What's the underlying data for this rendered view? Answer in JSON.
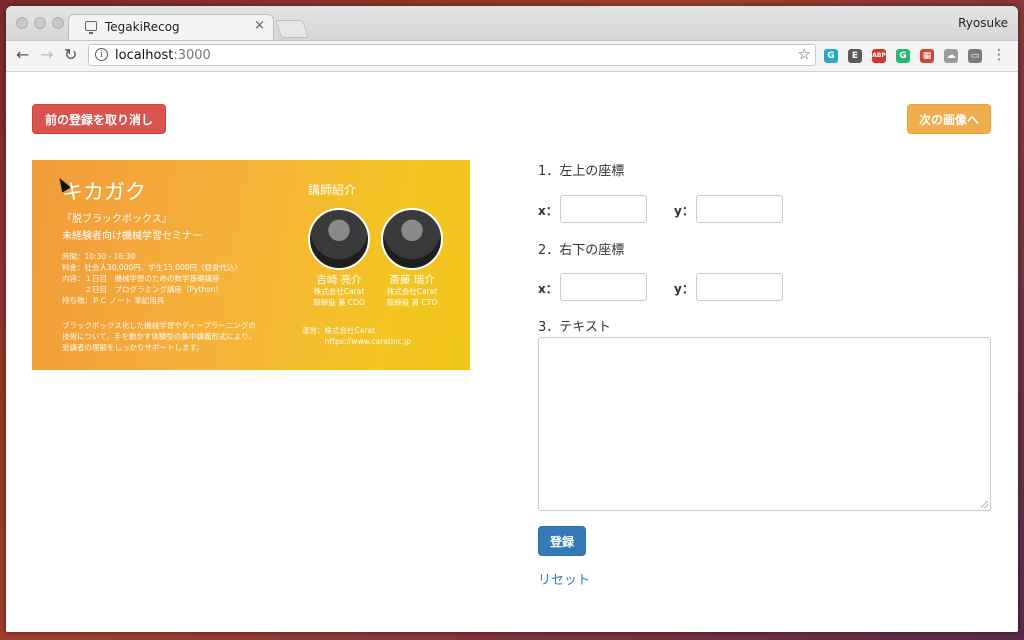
{
  "browser": {
    "tab_title": "TegakiRecog",
    "tab_close": "×",
    "profile_name": "Ryosuke",
    "url_host": "localhost",
    "url_port": ":3000",
    "nav": {
      "back": "←",
      "forward": "→",
      "reload": "↻"
    },
    "star": "☆",
    "menu": "⋮",
    "extensions": [
      {
        "name": "grammarly-ext-icon",
        "glyph": "G",
        "color": "#2aa7c9"
      },
      {
        "name": "evernote-ext-icon",
        "glyph": "E",
        "color": "#5a5a5a"
      },
      {
        "name": "adblock-ext-icon",
        "glyph": "ABP",
        "color": "#d9342b"
      },
      {
        "name": "g-ext-icon",
        "glyph": "G",
        "color": "#2bb673"
      },
      {
        "name": "grid-ext-icon",
        "glyph": "▦",
        "color": "#d2433a"
      },
      {
        "name": "cloud-ext-icon",
        "glyph": "☁",
        "color": "#9a9a9a"
      },
      {
        "name": "window-ext-icon",
        "glyph": "▭",
        "color": "#7a7a7a"
      }
    ]
  },
  "page": {
    "undo_button": "前の登録を取り消し",
    "next_button": "次の画像へ",
    "section1": "1．左上の座標",
    "section2": "2．右下の座標",
    "section3": "3．テキスト",
    "x_label": "x：",
    "y_label": "y：",
    "fields": {
      "x1": "",
      "y1": "",
      "x2": "",
      "y2": "",
      "text": ""
    },
    "submit_button": "登録",
    "reset_link": "リセット"
  },
  "image": {
    "title": "キカガク",
    "subtitle1": "『脱ブラックボックス』",
    "subtitle2": "未経験者向け機械学習セミナー",
    "details": "時間：10:30 - 18:30\n料金：社会人30,000円、学生15,000円（昼食代込）\n内容：１日目　機械学習のための数学基礎講座\n　　　２日目　プログラミング講座（Python）\n持ち物：ＰＣ ノート 筆記用具",
    "description": "ブラックボックス化した機械学習やディープラーニングの\n技術について、手を動かす体験型の集中講義形式により、\n受講者の理解をしっかりサポートします。",
    "speakers_heading": "講師紹介",
    "speaker1_name": "吉崎 亮介",
    "speaker1_role": "株式会社Carat\n取締役 兼 COO",
    "speaker2_name": "斎藤 瑞介",
    "speaker2_role": "株式会社Carat\n取締役 兼 CTO",
    "organizer": "運営：株式会社Carat\n　　　https://www.caratinc.jp"
  }
}
